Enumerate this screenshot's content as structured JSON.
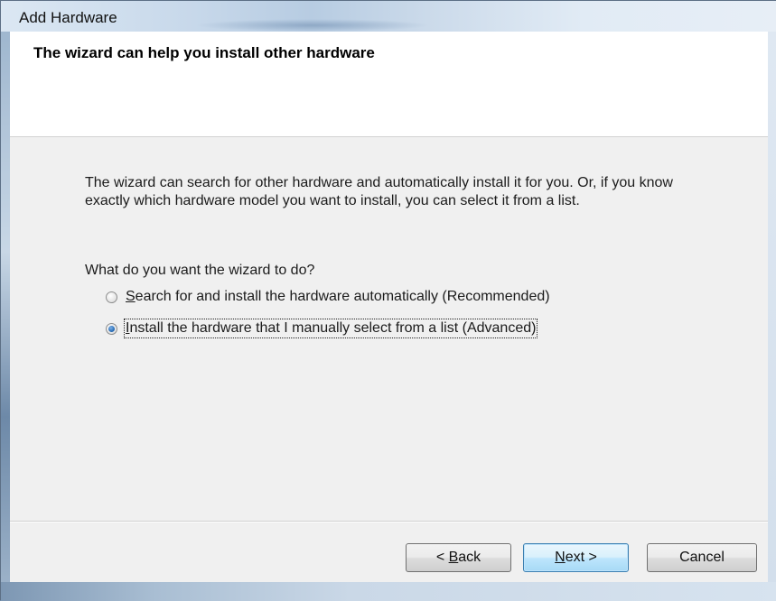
{
  "window": {
    "title": "Add Hardware"
  },
  "header": {
    "title": "The wizard can help you install other hardware"
  },
  "body": {
    "description": "The wizard can search for other hardware and automatically install it for you. Or, if you know exactly which hardware model you want to install, you can select it from a list.",
    "question": "What do you want the wizard to do?"
  },
  "options": [
    {
      "mnemonic": "S",
      "rest": "earch for and install the hardware automatically (Recommended)",
      "selected": false
    },
    {
      "mnemonic": "I",
      "rest": "nstall the hardware that I manually select from a list (Advanced)",
      "selected": true
    }
  ],
  "buttons": {
    "back_prefix": "< ",
    "back_mnemonic": "B",
    "back_rest": "ack",
    "next_mnemonic": "N",
    "next_rest": "ext >",
    "cancel": "Cancel"
  },
  "colors": {
    "accent": "#3c7fb1",
    "client_background": "#f0f0f0",
    "header_background": "#ffffff"
  }
}
